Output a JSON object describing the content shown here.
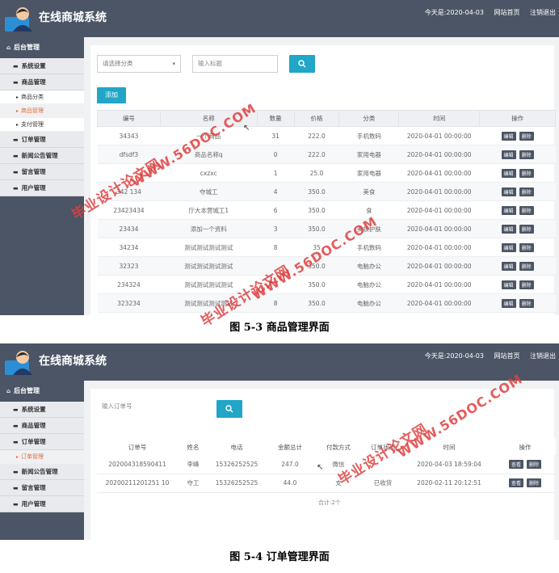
{
  "brand": {
    "title": "在线商城系统"
  },
  "topbar": {
    "date": "今天是:2020-04-03",
    "home_link": "网站首页",
    "logout_link": "注销退出"
  },
  "sidebar": {
    "head": "后台管理",
    "shot1_items": [
      {
        "label": "系统设置"
      },
      {
        "label": "商品管理"
      }
    ],
    "shot1_subs": [
      {
        "label": "商品分类",
        "active": false
      },
      {
        "label": "商品管理",
        "active": true
      },
      {
        "label": "支付管理",
        "active": false
      }
    ],
    "shot1_rest": [
      {
        "label": "订单管理"
      },
      {
        "label": "新闻公告管理"
      },
      {
        "label": "留言管理"
      },
      {
        "label": "用户管理"
      }
    ],
    "shot2_items": [
      {
        "label": "系统设置"
      },
      {
        "label": "商品管理"
      },
      {
        "label": "订单管理"
      }
    ],
    "shot2_subs": [
      {
        "label": "订单管理",
        "active": true
      }
    ],
    "shot2_rest": [
      {
        "label": "新闻公告管理"
      },
      {
        "label": "留言管理"
      },
      {
        "label": "用户管理"
      }
    ]
  },
  "goods": {
    "category_placeholder": "请选择分类",
    "title_placeholder": "输入标题",
    "add_label": "添加",
    "headers": [
      "编号",
      "名称",
      "数量",
      "价格",
      "分类",
      "时间",
      "操作"
    ],
    "edit_label": "编辑",
    "delete_label": "删除",
    "rows": [
      {
        "id": "34343",
        "name": "一个商品",
        "qty": "31",
        "price": "222.0",
        "cat": "手机数码",
        "time": "2020-04-01 00:00:00"
      },
      {
        "id": "dfsdf3",
        "name": "商品名称q",
        "qty": "0",
        "price": "222.0",
        "cat": "家用电器",
        "time": "2020-04-01 00:00:00"
      },
      {
        "id": "",
        "name": "cxzxc",
        "qty": "1",
        "price": "25.0",
        "cat": "家用电器",
        "time": "2020-04-01 00:00:00"
      },
      {
        "id": "342 134",
        "name": "夺城工",
        "qty": "4",
        "price": "350.0",
        "cat": "美食",
        "time": "2020-04-01 00:00:00"
      },
      {
        "id": "23423434",
        "name": "厅大本营城工1",
        "qty": "6",
        "price": "350.0",
        "cat": "食",
        "time": "2020-04-01 00:00:00"
      },
      {
        "id": "23434",
        "name": "添加一个资料",
        "qty": "3",
        "price": "350.0",
        "cat": "美妆护肤",
        "time": "2020-04-01 00:00:00"
      },
      {
        "id": "34234",
        "name": "测试测试测试测试",
        "qty": "8",
        "price": "35",
        "cat": "手机数码",
        "time": "2020-04-01 00:00:00"
      },
      {
        "id": "32323",
        "name": "测试测试测试测试",
        "qty": "",
        "price": "350.0",
        "cat": "电脑办公",
        "time": "2020-04-01 00:00:00"
      },
      {
        "id": "234324",
        "name": "测试测试测试测试",
        "qty": "",
        "price": "350.0",
        "cat": "电脑办公",
        "time": "2020-04-01 00:00:00"
      },
      {
        "id": "323234",
        "name": "测试测试测试测试",
        "qty": "8",
        "price": "350.0",
        "cat": "电脑办公",
        "time": "2020-04-01 00:00:00"
      }
    ]
  },
  "orders": {
    "search_placeholder": "输入订单号",
    "headers": [
      "订单号",
      "姓名",
      "电话",
      "金额总计",
      "付款方式",
      "订单状态",
      "时间",
      "操作"
    ],
    "view_label": "查看",
    "delete_label": "删除",
    "rows": [
      {
        "no": "202004318590411",
        "name": "李峰",
        "phone": "15326252525",
        "amount": "247.0",
        "pay": "微信",
        "status": "",
        "time": "2020-04-03 18:59:04"
      },
      {
        "no": "20200211201251 10",
        "name": "夺工",
        "phone": "15326252525",
        "amount": "44.0",
        "pay": "支",
        "status": "已收货",
        "time": "2020-02-11 20:12:51"
      }
    ],
    "total": "合计:2个"
  },
  "captions": {
    "fig1": "图 5-3  商品管理界面",
    "fig2": "图 5-4  订单管理界面"
  },
  "watermarks": {
    "url": "WWW.56DOC.COM",
    "site": "毕业设计论文网"
  },
  "colors": {
    "topbar": "#4b5565",
    "accent": "#21a6c7",
    "active_menu": "#e26a3a",
    "watermark": "#e04040"
  }
}
